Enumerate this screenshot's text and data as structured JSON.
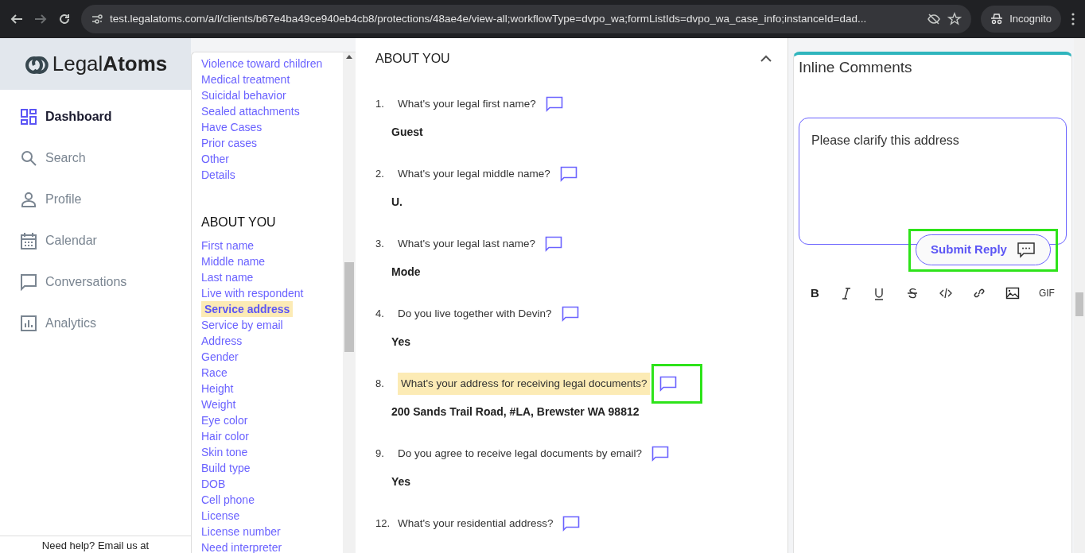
{
  "browser": {
    "url": "test.legalatoms.com/a/l/clients/b67e4ba49ce940eb4cb8/protections/48ae4e/view-all;workflowType=dvpo_wa;formListIds=dvpo_wa_case_info;instanceId=dad...",
    "profile": "Incognito"
  },
  "logo": {
    "part1": "Legal",
    "part2": "Atoms"
  },
  "nav": [
    {
      "label": "Dashboard",
      "selected": true
    },
    {
      "label": "Search",
      "selected": false
    },
    {
      "label": "Profile",
      "selected": false
    },
    {
      "label": "Calendar",
      "selected": false
    },
    {
      "label": "Conversations",
      "selected": false
    },
    {
      "label": "Analytics",
      "selected": false
    }
  ],
  "help": "Need help? Email us at",
  "outline": [
    {
      "kind": "links",
      "items": [
        {
          "label": "Violence toward children",
          "selected": false
        },
        {
          "label": "Medical treatment",
          "selected": false
        },
        {
          "label": "Suicidal behavior",
          "selected": false
        },
        {
          "label": "Sealed attachments",
          "selected": false
        },
        {
          "label": "Have Cases",
          "selected": false
        },
        {
          "label": "Prior cases",
          "selected": false
        },
        {
          "label": "Other",
          "selected": false
        },
        {
          "label": "Details",
          "selected": false
        }
      ]
    },
    {
      "kind": "section",
      "title": "ABOUT YOU",
      "items": [
        {
          "label": "First name",
          "selected": false
        },
        {
          "label": "Middle name",
          "selected": false
        },
        {
          "label": "Last name",
          "selected": false
        },
        {
          "label": "Live with respondent",
          "selected": false
        },
        {
          "label": "Service address",
          "selected": true
        },
        {
          "label": "Service by email",
          "selected": false
        },
        {
          "label": "Address",
          "selected": false
        },
        {
          "label": "Gender",
          "selected": false
        },
        {
          "label": "Race",
          "selected": false
        },
        {
          "label": "Height",
          "selected": false
        },
        {
          "label": "Weight",
          "selected": false
        },
        {
          "label": "Eye color",
          "selected": false
        },
        {
          "label": "Hair color",
          "selected": false
        },
        {
          "label": "Skin tone",
          "selected": false
        },
        {
          "label": "Build type",
          "selected": false
        },
        {
          "label": "DOB",
          "selected": false
        },
        {
          "label": "Cell phone",
          "selected": false
        },
        {
          "label": "License",
          "selected": false
        },
        {
          "label": "License number",
          "selected": false
        },
        {
          "label": "Need interpreter",
          "selected": false
        }
      ]
    }
  ],
  "section": {
    "title": "ABOUT YOU",
    "expanded": true
  },
  "questions": [
    {
      "number": "1.",
      "text": "What's your legal first name?",
      "answer": "Guest",
      "selected": false,
      "annotated": false
    },
    {
      "number": "2.",
      "text": "What's your legal middle name?",
      "answer": "U.",
      "selected": false,
      "annotated": false
    },
    {
      "number": "3.",
      "text": "What's your legal last name?",
      "answer": "Mode",
      "selected": false,
      "annotated": false
    },
    {
      "number": "4.",
      "text": "Do you live together with Devin?",
      "answer": "Yes",
      "selected": false,
      "annotated": false
    },
    {
      "number": "8.",
      "text": "What's your address for receiving legal documents?",
      "answer": "200 Sands Trail Road, #LA, Brewster WA 98812",
      "selected": true,
      "annotated": true
    },
    {
      "number": "9.",
      "text": "Do you agree to receive legal documents by email?",
      "answer": "Yes",
      "selected": false,
      "annotated": false
    },
    {
      "number": "12.",
      "text": "What's your residential address?",
      "selected": false,
      "annotated": false
    }
  ],
  "comments": {
    "title": "Inline Comments",
    "value": "Please clarify this address",
    "submit": {
      "label": "Submit Reply",
      "annotated": true
    },
    "toolbar": [
      {
        "kind": "bold",
        "label": "B"
      },
      {
        "kind": "italic"
      },
      {
        "kind": "underline"
      },
      {
        "kind": "strike"
      },
      {
        "kind": "code"
      },
      {
        "kind": "link"
      },
      {
        "kind": "image"
      },
      {
        "kind": "gif",
        "label": "GIF"
      }
    ]
  }
}
